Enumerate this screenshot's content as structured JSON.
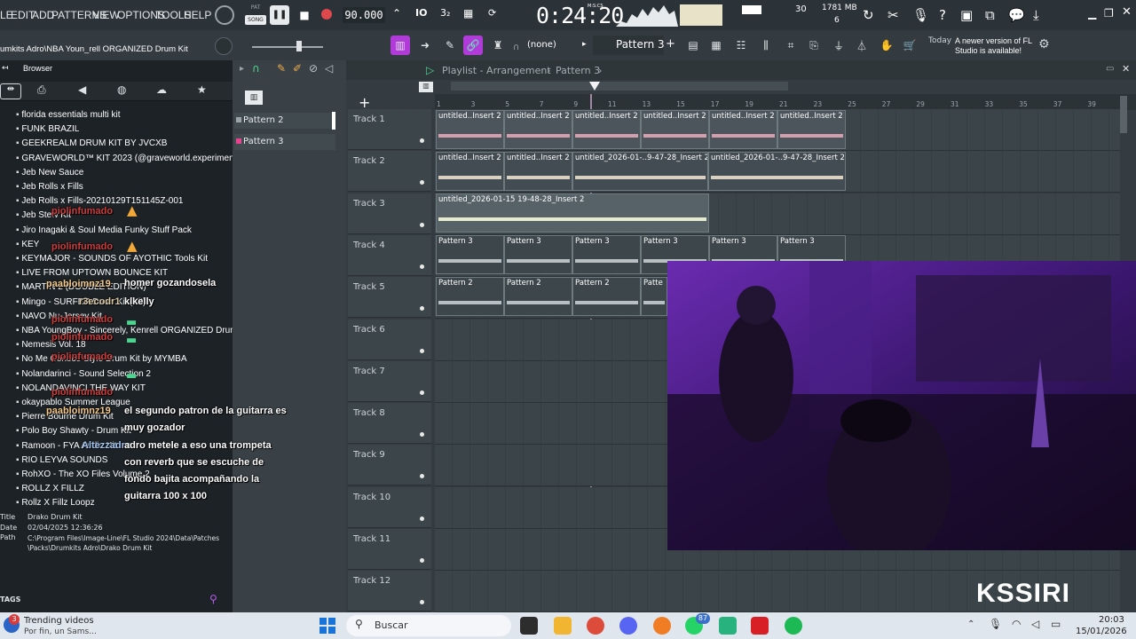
{
  "menu": [
    "LE",
    "EDIT",
    "ADD",
    "PATTERNS",
    "VIEW",
    "OPTIONS",
    "TOOLS",
    "HELP"
  ],
  "transport": {
    "mode_pat": "PAT",
    "mode_song": "SONG",
    "tempo": "90.000",
    "time": "0:24:20",
    "time_unit": "M:S:CS",
    "cpu": "30",
    "memory": "1781 MB",
    "voices": "6"
  },
  "row2": {
    "file_hint": "umkits Adro\\NBA Youn_rell ORGANIZED Drum Kit",
    "snap": "(none)",
    "pattern": "Pattern 3",
    "news_today": "Today",
    "news_text": "A newer version of FL Studio is available!"
  },
  "browser": {
    "title": "Browser",
    "items": [
      "florida essentials multi kit",
      "FUNK BRAZIL",
      "GEEKREALM DRUM KIT BY JVCXB",
      "GRAVEWORLD™ KIT 2023 (@graveworld.experiment)",
      "Jeb New Sauce",
      "Jeb Rolls x Fills",
      "Jeb Rolls x Fills-20210129T151145Z-001",
      "Jeb Stew Kit",
      "Jiro Inagaki & Soul Media  Funky Stuff Pack",
      "KEY",
      "KEYMAJOR - SOUNDS OF AYOTHIC Tools Kit",
      "LIVE FROM UPTOWN BOUNCE KIT",
      "MARTIN 2 (DOUBLE EDITION)",
      "Mingo - SURFER Drum Kit (Kit)",
      "NAVO Nu-Jersey Kit",
      "NBA YoungBoy - Sincerely, Kenrell ORGANIZED Drum Kit",
      "Nemesis Vol. 18",
      "No Me Conoce Style Drum Kit by MYMBA",
      "Nolandarinci - Sound Selection 2",
      "NOLANDAVINCI THE WAY KIT",
      "okaypablo Summer League",
      "Pierre Bourne Drum Kit",
      "Polo Boy Shawty - Drum Kit",
      "Ramoon - FYA Audio Kit",
      "RIO LEYVA SOUNDS",
      "RohXO - The XO Files Volume 2",
      "ROLLZ X FILLZ",
      "Rollz X Fillz Loopz"
    ],
    "info_title_label": "Title",
    "info_title": "Drako Drum Kit",
    "info_date_label": "Date",
    "info_date": "02/04/2025 12:36:26",
    "info_path_label": "Path",
    "info_path": "C:\\Program Files\\Image-Line\\FL Studio 2024\\Data\\Patches\\Packs\\Drumkits Adro\\Drako Drum Kit",
    "tags": "TAGS"
  },
  "channel_rack": {
    "patterns": [
      "Pattern 2",
      "Pattern 3"
    ]
  },
  "playlist": {
    "title": "Playlist - Arrangement",
    "crumb": "Pattern 3",
    "ruler": [
      "1",
      "3",
      "5",
      "7",
      "9",
      "11",
      "13",
      "15",
      "17",
      "19",
      "21",
      "23",
      "25",
      "27",
      "29",
      "31",
      "33",
      "35",
      "37",
      "39"
    ],
    "tracks": [
      "Track 1",
      "Track 2",
      "Track 3",
      "Track 4",
      "Track 5",
      "Track 6",
      "Track 7",
      "Track 8",
      "Track 9",
      "Track 10",
      "Track 11",
      "Track 12"
    ],
    "clip_insert": "untitled..Insert 2",
    "clip_long": "untitled_2026-01-..9-47-28_Insert 2",
    "clip_track3": "untitled_2026-01-15 19-48-28_Insert 2",
    "clip_p3": "Pattern 3",
    "clip_p2": "Pattern 2",
    "clip_p2_cut": "Patte"
  },
  "chat": [
    {
      "user": "piolinfumado",
      "text": ""
    },
    {
      "user": "piolinfumado",
      "text": ""
    },
    {
      "user": "paabloimnz19",
      "text": "homer gozandosela"
    },
    {
      "user": "r3ecodr1",
      "text": "klkelly"
    },
    {
      "user": "piolinfumado",
      "text": ""
    },
    {
      "user": "piolinfumado",
      "text": ""
    },
    {
      "user": "piolinfumado",
      "text": ""
    },
    {
      "user": "piolinfumado",
      "text": ""
    },
    {
      "user": "paabloimnz19",
      "text": "el segundo patron de la guitarra es"
    },
    {
      "user": "",
      "text": "muy gozador"
    },
    {
      "user": "Altezzadro",
      "text": "adro metele a eso una trompeta"
    },
    {
      "user": "",
      "text": "con reverb que se escuche de"
    },
    {
      "user": "",
      "text": "fondo bajita acompañando la"
    },
    {
      "user": "",
      "text": "guitarra 100 x 100"
    }
  ],
  "overlay": {
    "brand": "KSSIRI"
  },
  "taskbar": {
    "notif_count": "3",
    "news_title": "Trending videos",
    "news_sub": "Por fin, un Sams...",
    "search": "Buscar",
    "whatsapp_badge": "87",
    "time": "20:03",
    "date": "15/01/2026"
  }
}
